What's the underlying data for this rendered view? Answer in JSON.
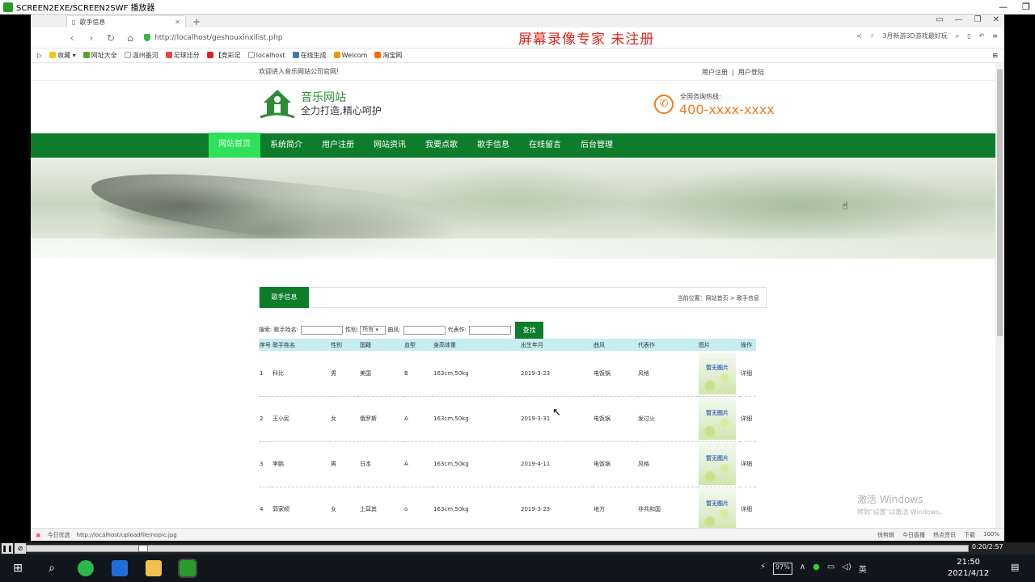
{
  "player": {
    "title": "SCREEN2EXE/SCREEN2SWF 播放器",
    "time": "0:20/2:57",
    "controls": [
      "pause",
      "stop"
    ]
  },
  "browser": {
    "tab_title": "歌手信息",
    "url": "http://localhost/geshouxinxilist.php",
    "watermark": "屏幕录像专家  未注册",
    "search_hint": "3月新游3D游戏最好玩",
    "bookmarks": [
      "收藏",
      "网址大全",
      "温州墨河",
      "足球比分",
      "【竞彩足",
      "localhost",
      "在线生成",
      "Welcom",
      "淘宝网"
    ],
    "status_left": "今日优选",
    "status_url": "http://localhost/uploadfile/nopic.jpg",
    "status_right": [
      "快剪辑",
      "今日直播",
      "热点资讯",
      "下载",
      "100%"
    ]
  },
  "site": {
    "welcome": "欢迎进入音乐网站公司官网!",
    "register_link": "用户注册",
    "separator": "|",
    "login_link": "用户登陆",
    "name": "音乐网站",
    "slogan": "全力打造,精心呵护",
    "hotline_label": "全国咨询热线:",
    "hotline": "400-xxxx-xxxx",
    "nav": [
      "网站首页",
      "系统简介",
      "用户注册",
      "网站资讯",
      "我要点歌",
      "歌手信息",
      "在线留言",
      "后台管理"
    ],
    "active_nav": "网站首页"
  },
  "panel": {
    "title": "歌手信息",
    "breadcrumb": "当前位置：网站首页 > 歌手信息"
  },
  "search": {
    "prefix": "搜索: 歌手姓名:",
    "gender_label": "性别:",
    "gender_value": "所有",
    "style_label": "曲风:",
    "works_label": "代表作:",
    "button": "查找"
  },
  "table": {
    "headers": [
      "序号",
      "歌手姓名",
      "性别",
      "国籍",
      "血型",
      "身高体重",
      "出生年月",
      "曲风",
      "代表作",
      "图片",
      "操作"
    ],
    "rows": [
      {
        "no": "1",
        "name": "科比",
        "gender": "男",
        "nation": "美国",
        "blood": "B",
        "body": "163cm,50kg",
        "birth": "2019-3-23",
        "style": "电饭锅",
        "works": "风格",
        "action": "详细"
      },
      {
        "no": "2",
        "name": "王小民",
        "gender": "女",
        "nation": "俄罗斯",
        "blood": "A",
        "body": "163cm,50kg",
        "birth": "2019-3-31",
        "style": "电饭锅",
        "works": "发过火",
        "action": "详细"
      },
      {
        "no": "3",
        "name": "李鹏",
        "gender": "男",
        "nation": "日本",
        "blood": "A",
        "body": "163cm,50kg",
        "birth": "2019-4-11",
        "style": "电饭锅",
        "works": "风格",
        "action": "详细"
      },
      {
        "no": "4",
        "name": "郭家顺",
        "gender": "女",
        "nation": "土耳其",
        "blood": "o",
        "body": "163cm,50kg",
        "birth": "2019-3-23",
        "style": "地方",
        "works": "非共和国",
        "action": "详细"
      }
    ],
    "thumb_text": "暂无图片"
  },
  "windows": {
    "activate_title": "激活 Windows",
    "activate_sub": "转到\"设置\"以激活 Windows。",
    "clock_time": "21:50",
    "clock_date": "2021/4/12",
    "battery": "97%",
    "ime": "英"
  },
  "colors": {
    "brand_green": "#0d7d2c",
    "active_nav": "#2ee05a",
    "hotline_orange": "#f07b1d",
    "table_header": "#c6eef0"
  }
}
